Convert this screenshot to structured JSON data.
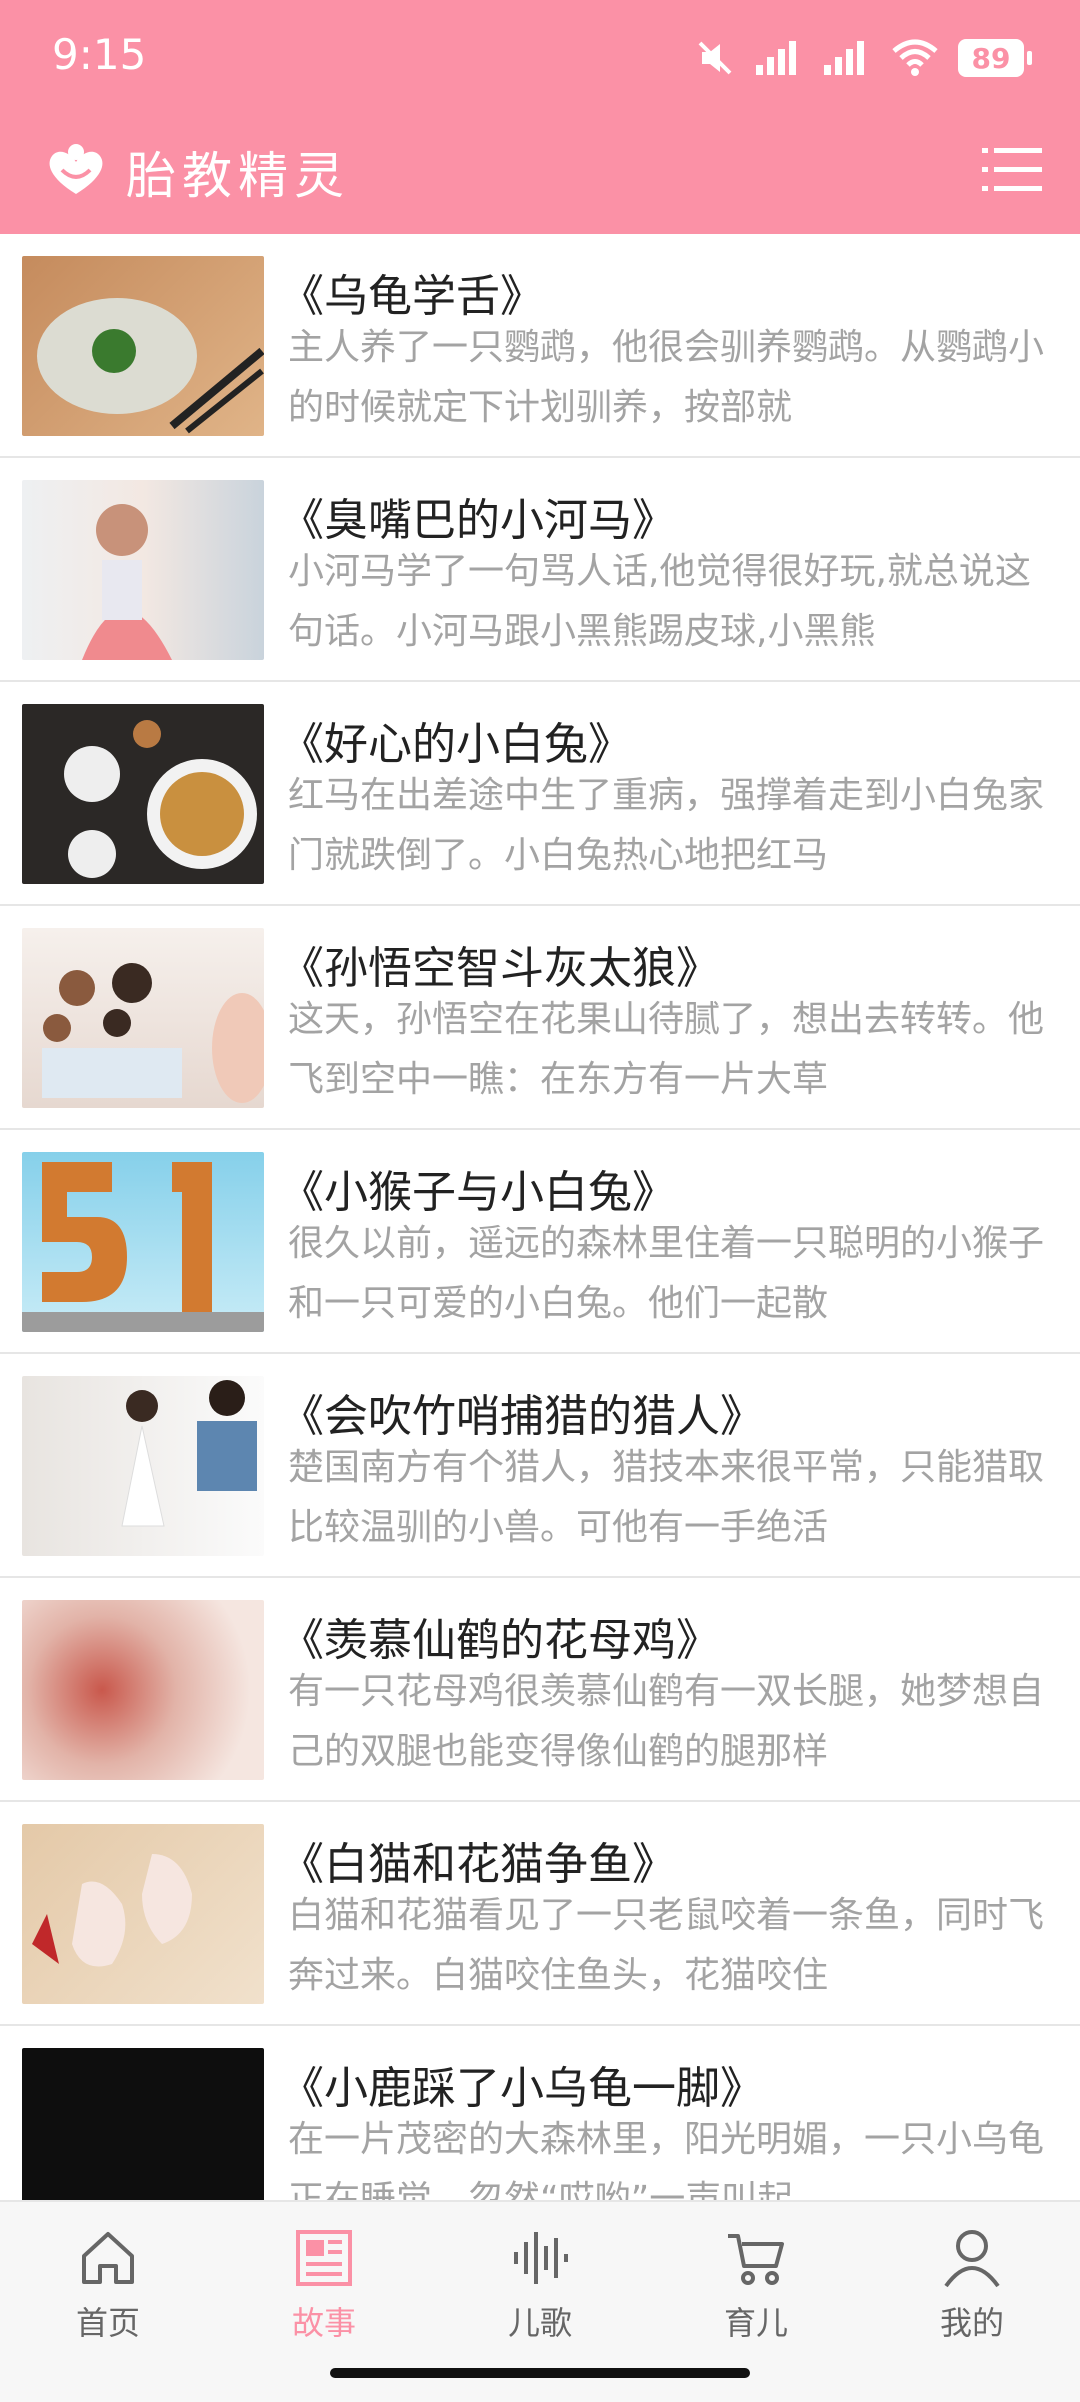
{
  "status": {
    "time": "9:15",
    "battery": "89"
  },
  "app": {
    "title": "胎教精灵"
  },
  "colors": {
    "brand": "#fb91a6",
    "text": "#222222",
    "muted": "#a3a3a3"
  },
  "stories": [
    {
      "title": "《乌龟学舌》",
      "desc": "主人养了一只鹦鹉，他很会驯养鹦鹉。从鹦鹉小的时候就定下计划驯养，按部就",
      "thumb_color": "#d09a6a"
    },
    {
      "title": "《臭嘴巴的小河马》",
      "desc": "小河马学了一句骂人话,他觉得很好玩,就总说这句话。小河马跟小黑熊踢皮球,小黑熊",
      "thumb_color": "#e8d0c8"
    },
    {
      "title": "《好心的小白兔》",
      "desc": "红马在出差途中生了重病，强撑着走到小白兔家门就跌倒了。小白兔热心地把红马",
      "thumb_color": "#2e2a28"
    },
    {
      "title": "《孙悟空智斗灰太狼》",
      "desc": "这天，孙悟空在花果山待腻了，想出去转转。他飞到空中一瞧：在东方有一片大草",
      "thumb_color": "#e8ddd6"
    },
    {
      "title": "《小猴子与小白兔》",
      "desc": "很久以前，遥远的森林里住着一只聪明的小猴子和一只可爱的小白兔。他们一起散",
      "thumb_color": "#7fc9e2"
    },
    {
      "title": "《会吹竹哨捕猎的猎人》",
      "desc": "楚国南方有个猎人，猎技本来很平常，只能猎取比较温驯的小兽。可他有一手绝活",
      "thumb_color": "#f2efec"
    },
    {
      "title": "《羡慕仙鹤的花母鸡》",
      "desc": "有一只花母鸡很羡慕仙鹤有一双长腿，她梦想自己的双腿也能变得像仙鹤的腿那样",
      "thumb_color": "#e3c0b4"
    },
    {
      "title": "《白猫和花猫争鱼》",
      "desc": "白猫和花猫看见了一只老鼠咬着一条鱼，同时飞奔过来。白猫咬住鱼头，花猫咬住",
      "thumb_color": "#e9d4bd"
    },
    {
      "title": "《小鹿踩了小乌龟一脚》",
      "desc": "在一片茂密的大森林里，阳光明媚，一只小乌龟正在睡觉，忽然“哎哟”一声叫起",
      "thumb_color": "#0e0e0e"
    }
  ],
  "nav": [
    {
      "label": "首页",
      "icon": "home-icon",
      "active": false
    },
    {
      "label": "故事",
      "icon": "story-icon",
      "active": true
    },
    {
      "label": "儿歌",
      "icon": "music-icon",
      "active": false
    },
    {
      "label": "育儿",
      "icon": "cart-icon",
      "active": false
    },
    {
      "label": "我的",
      "icon": "profile-icon",
      "active": false
    }
  ]
}
